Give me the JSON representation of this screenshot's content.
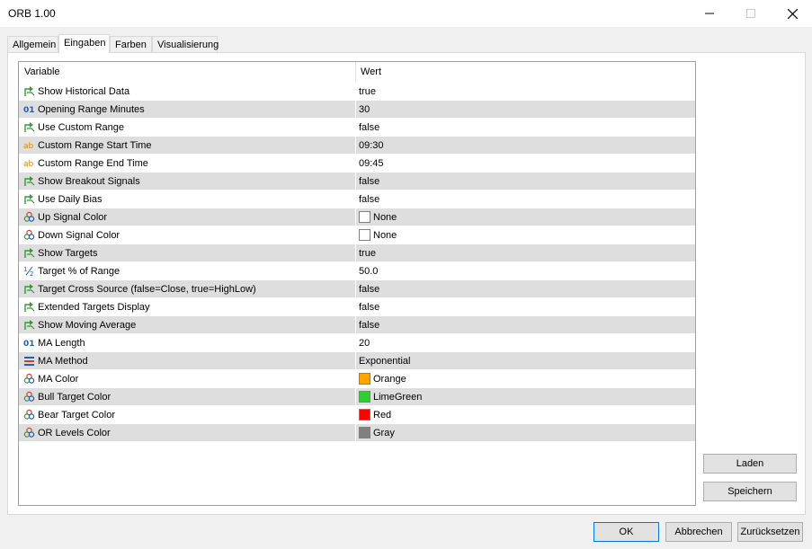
{
  "window": {
    "title": "ORB 1.00"
  },
  "tabs": [
    "Allgemein",
    "Eingaben",
    "Farben",
    "Visualisierung"
  ],
  "grid": {
    "col_variable": "Variable",
    "col_value": "Wert",
    "rows": [
      {
        "icon": "bool-icon",
        "name": "Show Historical Data",
        "value": "true"
      },
      {
        "icon": "integer-icon",
        "name": "Opening Range Minutes",
        "value": "30"
      },
      {
        "icon": "bool-icon",
        "name": "Use Custom Range",
        "value": "false"
      },
      {
        "icon": "string-icon",
        "name": "Custom Range Start Time",
        "value": "09:30"
      },
      {
        "icon": "string-icon",
        "name": "Custom Range End Time",
        "value": "09:45"
      },
      {
        "icon": "bool-icon",
        "name": "Show Breakout Signals",
        "value": "false"
      },
      {
        "icon": "bool-icon",
        "name": "Use Daily Bias",
        "value": "false"
      },
      {
        "icon": "color-icon",
        "name": "Up Signal Color",
        "value": "None",
        "swatch": "#ffffff"
      },
      {
        "icon": "color-icon",
        "name": "Down Signal Color",
        "value": "None",
        "swatch": "#ffffff"
      },
      {
        "icon": "bool-icon",
        "name": "Show Targets",
        "value": "true"
      },
      {
        "icon": "fraction-icon",
        "name": "Target % of Range",
        "value": "50.0"
      },
      {
        "icon": "bool-icon",
        "name": "Target Cross Source (false=Close, true=HighLow)",
        "value": "false"
      },
      {
        "icon": "bool-icon",
        "name": "Extended Targets Display",
        "value": "false"
      },
      {
        "icon": "bool-icon",
        "name": "Show Moving Average",
        "value": "false"
      },
      {
        "icon": "integer-icon",
        "name": "MA Length",
        "value": "20"
      },
      {
        "icon": "enum-icon",
        "name": "MA Method",
        "value": "Exponential"
      },
      {
        "icon": "color-icon",
        "name": "MA Color",
        "value": "Orange",
        "swatch": "#ffa500"
      },
      {
        "icon": "color-icon",
        "name": "Bull Target Color",
        "value": "LimeGreen",
        "swatch": "#32cd32"
      },
      {
        "icon": "color-icon",
        "name": "Bear Target Color",
        "value": "Red",
        "swatch": "#ff0000"
      },
      {
        "icon": "color-icon",
        "name": "OR Levels Color",
        "value": "Gray",
        "swatch": "#808080"
      }
    ]
  },
  "side_buttons": {
    "load": "Laden",
    "save": "Speichern"
  },
  "footer_buttons": {
    "ok": "OK",
    "cancel": "Abbrechen",
    "reset": "Zurücksetzen"
  }
}
